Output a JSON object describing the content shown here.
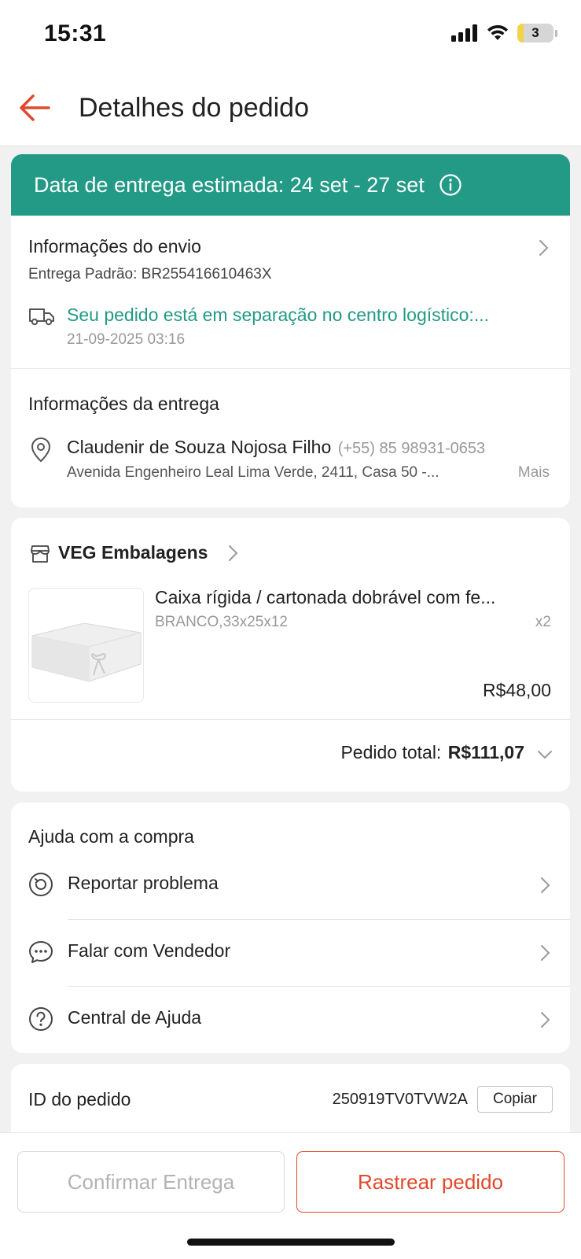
{
  "status": {
    "time": "15:31",
    "battery": "3"
  },
  "header": {
    "title": "Detalhes do pedido"
  },
  "delivery_banner": {
    "text": "Data de entrega estimada: 24 set - 27 set"
  },
  "shipping": {
    "title": "Informações do envio",
    "service": "Entrega Padrão: BR255416610463X",
    "status_text": "Seu pedido está em separação no centro logístico:...",
    "status_time": "21-09-2025 03:16"
  },
  "delivery": {
    "title": "Informações da entrega",
    "name": "Claudenir de Souza Nojosa Filho",
    "phone": "(+55) 85 98931-0653",
    "address": "Avenida Engenheiro Leal Lima Verde, 2411, Casa 50 -...",
    "more": "Mais"
  },
  "shop": {
    "name": "VEG Embalagens",
    "product_name": "Caixa rígida / cartonada dobrável com  fe...",
    "variant": "BRANCO,33x25x12",
    "quantity": "x2",
    "price": "R$48,00",
    "total_label": "Pedido total:",
    "total_value": "R$111,07"
  },
  "help": {
    "title": "Ajuda com a compra",
    "items": [
      {
        "label": "Reportar problema",
        "icon": "report-icon"
      },
      {
        "label": "Falar com Vendedor",
        "icon": "chat-icon"
      },
      {
        "label": "Central de Ajuda",
        "icon": "help-icon"
      }
    ]
  },
  "order": {
    "id_label": "ID do pedido",
    "id_value": "250919TV0TVW2A",
    "copy_label": "Copiar"
  },
  "actions": {
    "confirm_label": "Confirmar Entrega",
    "track_label": "Rastrear pedido"
  },
  "colors": {
    "accent": "#e0492b",
    "teal": "#229a86"
  }
}
